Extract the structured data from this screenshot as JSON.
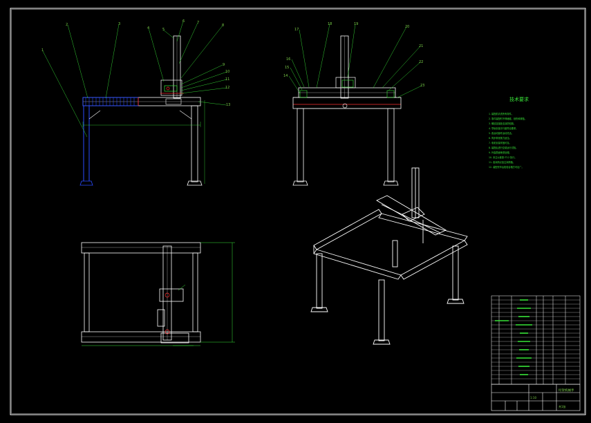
{
  "drawing": {
    "background": "#000000",
    "colors": {
      "frame": "#ffffff",
      "leader": "#39e639",
      "blue": "#2a4cff",
      "red": "#ff3030",
      "dim": "#39e639"
    }
  },
  "front_view": {
    "callouts": [
      "1",
      "2",
      "3",
      "4",
      "5",
      "6",
      "7",
      "8",
      "9",
      "10",
      "11",
      "12",
      "13"
    ]
  },
  "side_view": {
    "callouts": [
      "14",
      "15",
      "16",
      "17",
      "18",
      "19",
      "20",
      "21",
      "22",
      "23"
    ]
  },
  "tech_notes": {
    "title": "技术要求",
    "lines": [
      "1. 装配前清洗所有零件。",
      "2. 零件装配时不得磕碰、划伤和锈蚀。",
      "3. 螺纹连接处应涂防松胶。",
      "4. 导轨安装平行度符合要求。",
      "5. 各运动部件运动灵活。",
      "6. 同步带张紧力适当。",
      "7. 电机安装牢固可靠。",
      "8. 装配后进行空载运行试验。",
      "9. 外露表面喷漆处理。",
      "10. 未注公差按 IT12 执行。",
      "11. 各润滑点加注润滑脂。",
      "12. 装配完毕后检验合格方可出厂。"
    ]
  },
  "title_block": {
    "drawing_name": "桁架机械手",
    "scale": "1:10",
    "sheet": "共1张"
  }
}
